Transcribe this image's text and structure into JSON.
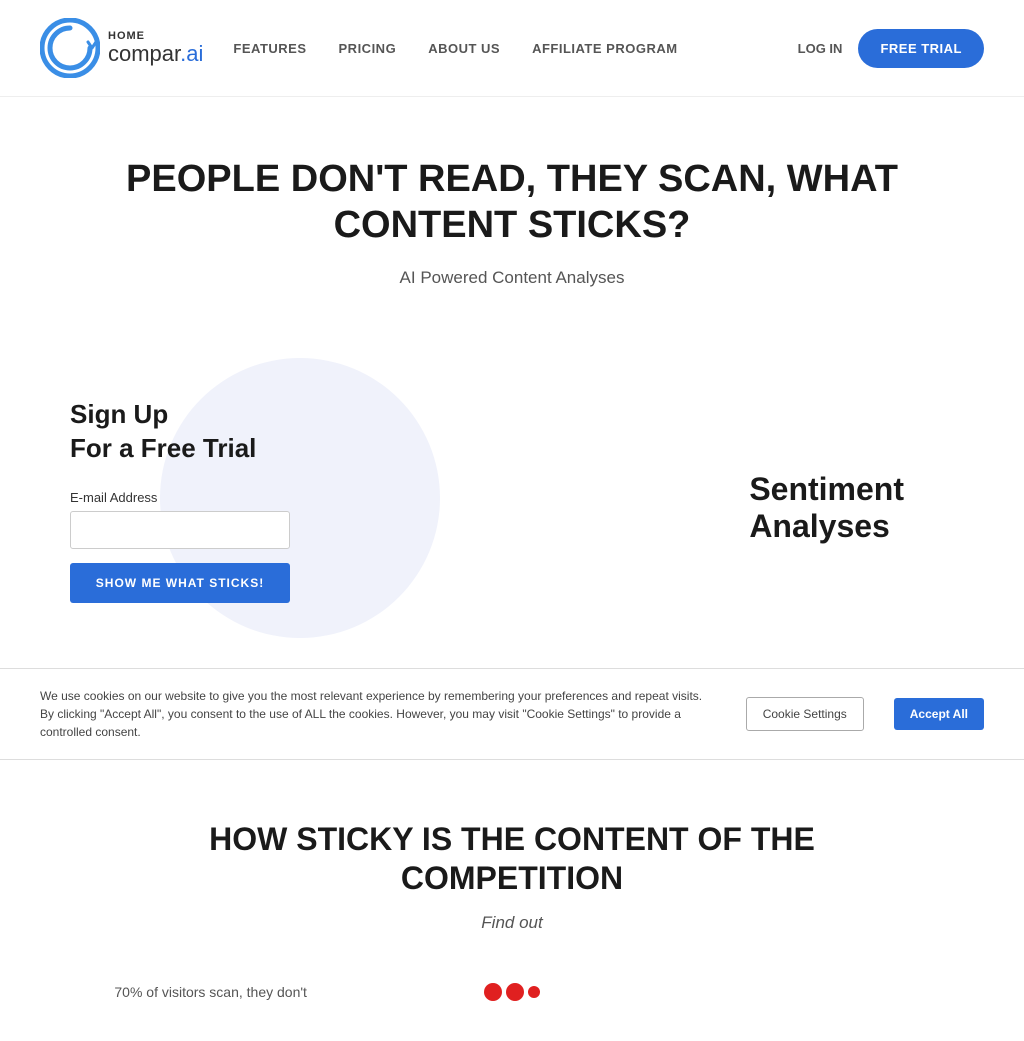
{
  "nav": {
    "logo_home": "HOME",
    "logo_brand_pre": "compar",
    "logo_brand_dot": ".",
    "logo_brand_post": "ai",
    "links": [
      {
        "label": "FEATURES",
        "name": "nav-features"
      },
      {
        "label": "PRICING",
        "name": "nav-pricing"
      },
      {
        "label": "ABOUT US",
        "name": "nav-about"
      },
      {
        "label": "AFFILIATE PROGRAM",
        "name": "nav-affiliate"
      }
    ],
    "login_label": "LOG IN",
    "free_trial_label": "FREE TRIAL"
  },
  "hero": {
    "title": "PEOPLE DON'T READ, THEY SCAN, WHAT CONTENT STICKS?",
    "subtitle": "AI Powered Content Analyses"
  },
  "signup": {
    "heading_line1": "Sign Up",
    "heading_line2": "For a Free Trial",
    "email_label": "E-mail Address",
    "email_placeholder": "",
    "submit_label": "SHOW ME WHAT STICKS!",
    "sentiment_label": "Sentiment Analyses"
  },
  "cookie": {
    "text": "We use cookies on our website to give you the most relevant experience by remembering your preferences and repeat visits. By clicking \"Accept All\", you consent to the use of ALL the cookies. However, you may visit \"Cookie Settings\" to provide a controlled consent.",
    "settings_label": "Cookie Settings",
    "accept_label": "Accept All"
  },
  "competition": {
    "title": "HOW STICKY IS THE CONTENT OF THE COMPETITION",
    "subtitle": "Find out",
    "stat_text": "70% of visitors scan, they don't"
  }
}
